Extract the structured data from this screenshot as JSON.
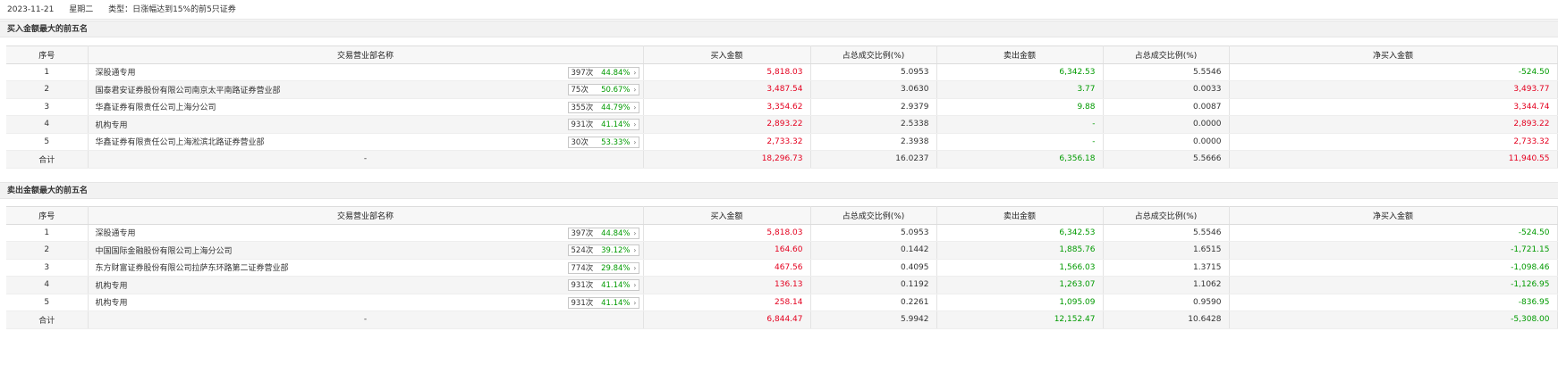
{
  "header": {
    "date": "2023-11-21",
    "weekday": "星期二",
    "type_label": "类型：日涨幅达到15%的前5只证券"
  },
  "columns": [
    "序号",
    "交易营业部名称",
    "买入金额",
    "占总成交比例(%)",
    "卖出金额",
    "占总成交比例(%)",
    "净买入金额"
  ],
  "sections": [
    {
      "title": "买入金额最大的前五名",
      "rows": [
        {
          "idx": "1",
          "name": "深股通专用",
          "count": "397次",
          "rate": "44.84%",
          "buy": "5,818.03",
          "buy_pct": "5.0953",
          "sell": "6,342.53",
          "sell_pct": "5.5546",
          "net": "-524.50"
        },
        {
          "idx": "2",
          "name": "国泰君安证券股份有限公司南京太平南路证券营业部",
          "count": "75次",
          "rate": "50.67%",
          "buy": "3,487.54",
          "buy_pct": "3.0630",
          "sell": "3.77",
          "sell_pct": "0.0033",
          "net": "3,493.77"
        },
        {
          "idx": "3",
          "name": "华鑫证券有限责任公司上海分公司",
          "count": "355次",
          "rate": "44.79%",
          "buy": "3,354.62",
          "buy_pct": "2.9379",
          "sell": "9.88",
          "sell_pct": "0.0087",
          "net": "3,344.74"
        },
        {
          "idx": "4",
          "name": "机构专用",
          "count": "931次",
          "rate": "41.14%",
          "buy": "2,893.22",
          "buy_pct": "2.5338",
          "sell": "-",
          "sell_pct": "0.0000",
          "net": "2,893.22"
        },
        {
          "idx": "5",
          "name": "华鑫证券有限责任公司上海淞滨北路证券营业部",
          "count": "30次",
          "rate": "53.33%",
          "buy": "2,733.32",
          "buy_pct": "2.3938",
          "sell": "-",
          "sell_pct": "0.0000",
          "net": "2,733.32"
        }
      ],
      "total": {
        "label": "合计",
        "name": "-",
        "buy": "18,296.73",
        "buy_pct": "16.0237",
        "sell": "6,356.18",
        "sell_pct": "5.5666",
        "net": "11,940.55"
      }
    },
    {
      "title": "卖出金额最大的前五名",
      "rows": [
        {
          "idx": "1",
          "name": "深股通专用",
          "count": "397次",
          "rate": "44.84%",
          "buy": "5,818.03",
          "buy_pct": "5.0953",
          "sell": "6,342.53",
          "sell_pct": "5.5546",
          "net": "-524.50"
        },
        {
          "idx": "2",
          "name": "中国国际金融股份有限公司上海分公司",
          "count": "524次",
          "rate": "39.12%",
          "buy": "164.60",
          "buy_pct": "0.1442",
          "sell": "1,885.76",
          "sell_pct": "1.6515",
          "net": "-1,721.15"
        },
        {
          "idx": "3",
          "name": "东方财富证券股份有限公司拉萨东环路第二证券营业部",
          "count": "774次",
          "rate": "29.84%",
          "buy": "467.56",
          "buy_pct": "0.4095",
          "sell": "1,566.03",
          "sell_pct": "1.3715",
          "net": "-1,098.46"
        },
        {
          "idx": "4",
          "name": "机构专用",
          "count": "931次",
          "rate": "41.14%",
          "buy": "136.13",
          "buy_pct": "0.1192",
          "sell": "1,263.07",
          "sell_pct": "1.1062",
          "net": "-1,126.95"
        },
        {
          "idx": "5",
          "name": "机构专用",
          "count": "931次",
          "rate": "41.14%",
          "buy": "258.14",
          "buy_pct": "0.2261",
          "sell": "1,095.09",
          "sell_pct": "0.9590",
          "net": "-836.95"
        }
      ],
      "total": {
        "label": "合计",
        "name": "-",
        "buy": "6,844.47",
        "buy_pct": "5.9942",
        "sell": "12,152.47",
        "sell_pct": "10.6428",
        "net": "-5,308.00"
      }
    }
  ],
  "colors": {
    "buy": "#e4001f",
    "sell": "#009a00",
    "positive": "#e4001f",
    "negative": "#009a00",
    "header_bg": "#f7f7f7"
  },
  "icons": {
    "badge_arrow": "chevron-right-icon"
  }
}
